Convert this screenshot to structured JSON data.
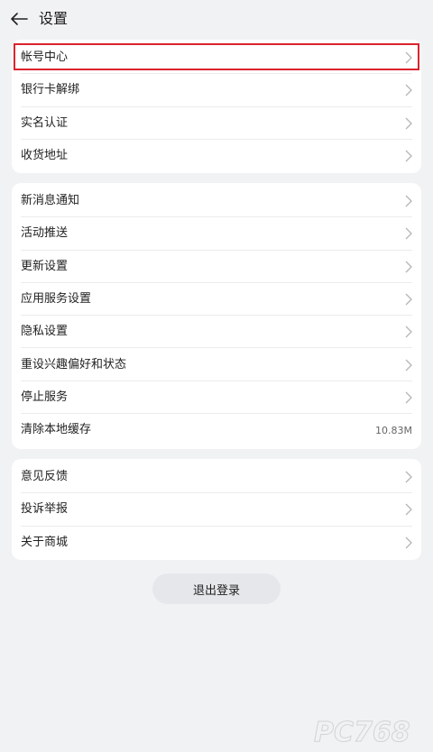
{
  "header": {
    "title": "设置"
  },
  "group1": {
    "items": [
      {
        "label": "帐号中心"
      },
      {
        "label": "银行卡解绑"
      },
      {
        "label": "实名认证"
      },
      {
        "label": "收货地址"
      }
    ]
  },
  "group2": {
    "items": [
      {
        "label": "新消息通知"
      },
      {
        "label": "活动推送"
      },
      {
        "label": "更新设置"
      },
      {
        "label": "应用服务设置"
      },
      {
        "label": "隐私设置"
      },
      {
        "label": "重设兴趣偏好和状态"
      },
      {
        "label": "停止服务"
      },
      {
        "label": "清除本地缓存",
        "value": "10.83M"
      }
    ]
  },
  "group3": {
    "items": [
      {
        "label": "意见反馈"
      },
      {
        "label": "投诉举报"
      },
      {
        "label": "关于商城"
      }
    ]
  },
  "logout": {
    "label": "退出登录"
  },
  "watermark": {
    "text": "PC768"
  },
  "colors": {
    "background": "#f1f2f4",
    "card": "#ffffff",
    "highlight": "#d9232e",
    "logout_bg": "#e6e7ea"
  }
}
